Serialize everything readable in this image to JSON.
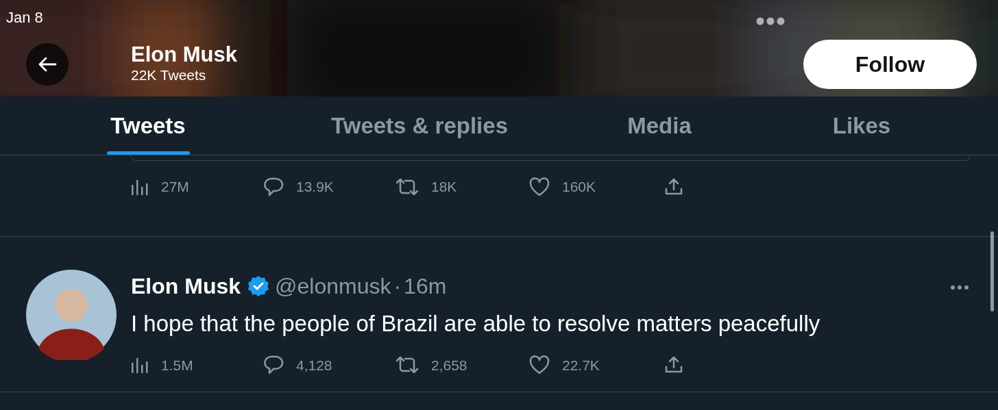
{
  "status_bar": {
    "date": "Jan 8"
  },
  "header": {
    "name": "Elon Musk",
    "tweet_count": "22K Tweets",
    "follow_button": "Follow"
  },
  "tabs": [
    {
      "label": "Tweets",
      "selected": true
    },
    {
      "label": "Tweets & replies",
      "selected": false
    },
    {
      "label": "Media",
      "selected": false
    },
    {
      "label": "Likes",
      "selected": false
    }
  ],
  "tweets": [
    {
      "kind": "partial",
      "stats": {
        "views": "27M",
        "replies": "13.9K",
        "retweets": "18K",
        "likes": "160K"
      }
    },
    {
      "kind": "full",
      "name": "Elon Musk",
      "verified": true,
      "handle": "@elonmusk",
      "separator": "·",
      "time": "16m",
      "text": "I hope that the people of Brazil are able to resolve matters peacefully",
      "stats": {
        "views": "1.5M",
        "replies": "4,128",
        "retweets": "2,658",
        "likes": "22.7K"
      }
    },
    {
      "kind": "cut"
    }
  ]
}
